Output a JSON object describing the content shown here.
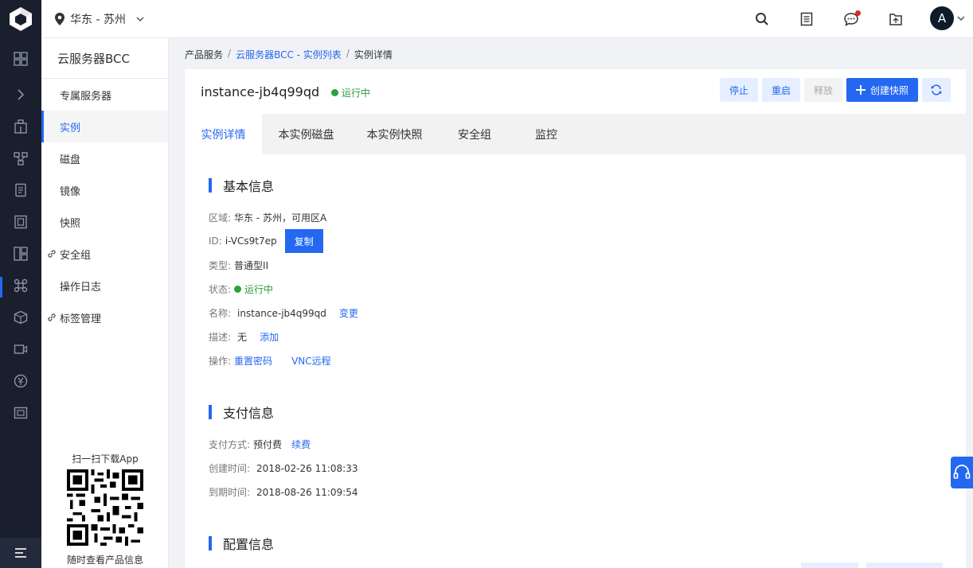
{
  "header": {
    "region": "华东 - 苏州",
    "avatar_letter": "A"
  },
  "sidebar": {
    "title": "云服务器BCC",
    "items": [
      {
        "label": "专属服务器"
      },
      {
        "label": "实例"
      },
      {
        "label": "磁盘"
      },
      {
        "label": "镜像"
      },
      {
        "label": "快照"
      },
      {
        "label": "安全组"
      },
      {
        "label": "操作日志"
      },
      {
        "label": "标签管理"
      }
    ],
    "qr_top": "扫一扫下载App",
    "qr_bottom": "随时查看产品信息"
  },
  "breadcrumb": {
    "root": "产品服务",
    "parent": "云服务器BCC - 实例列表",
    "current": "实例详情",
    "sep": "/"
  },
  "instance": {
    "name": "instance-jb4q99qd",
    "status": "运行中",
    "status_color": "#2aa33a"
  },
  "actions": {
    "stop": "停止",
    "restart": "重启",
    "release": "释放",
    "snapshot": "创建快照"
  },
  "tabs": [
    "实例详情",
    "本实例磁盘",
    "本实例快照",
    "安全组",
    "监控"
  ],
  "basic": {
    "title": "基本信息",
    "region_label": "区域:",
    "region_value": "华东 - 苏州，可用区A",
    "id_label": "ID:",
    "id_value": "i-VCs9t7ep",
    "copy": "复制",
    "type_label": "类型:",
    "type_value": "普通型II",
    "state_label": "状态:",
    "state_value": "运行中",
    "name_label": "名称:",
    "name_value": "instance-jb4q99qd",
    "name_action": "变更",
    "desc_label": "描述:",
    "desc_value": "无",
    "desc_action": "添加",
    "op_label": "操作:",
    "op_reset": "重置密码",
    "op_vnc": "VNC远程"
  },
  "payment": {
    "title": "支付信息",
    "method_label": "支付方式:",
    "method_value": "预付费",
    "renew": "续费",
    "created_label": "创建时间:",
    "created_value": "2018-02-26 11:08:33",
    "expire_label": "到期时间:",
    "expire_value": "2018-08-26 11:09:54"
  },
  "config": {
    "title": "配置信息"
  },
  "colors": {
    "accent": "#2468f2",
    "rail": "#1a1f2e",
    "notify": "#e0252b"
  }
}
